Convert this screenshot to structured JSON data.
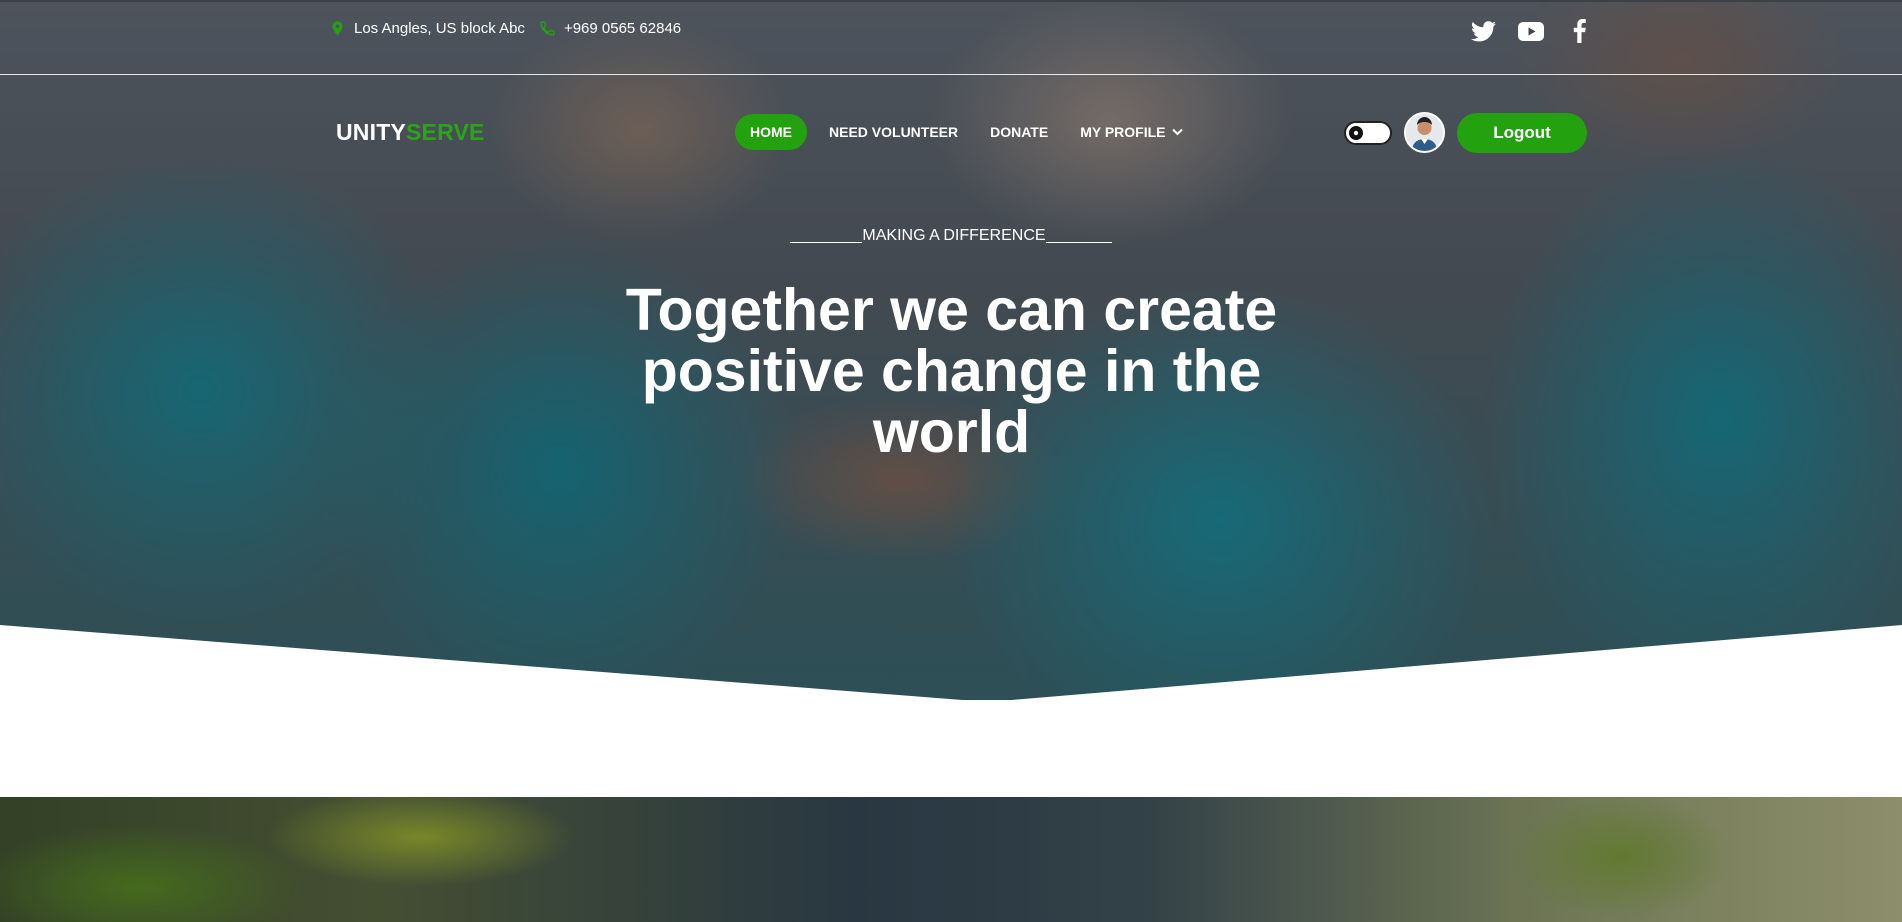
{
  "topbar": {
    "address": "Los Angles, US block Abc",
    "phone": "+969 0565 62846",
    "social": [
      {
        "name": "twitter-icon"
      },
      {
        "name": "youtube-icon"
      },
      {
        "name": "facebook-icon"
      }
    ]
  },
  "brand": {
    "part1": "UNITY",
    "part2": "SERVE"
  },
  "nav": {
    "home": "HOME",
    "need_volunteer": "NEED VOLUNTEER",
    "donate": "DONATE",
    "my_profile": "MY PROFILE"
  },
  "actions": {
    "logout": "Logout"
  },
  "hero": {
    "eyebrow": "MAKING A DIFFERENCE",
    "headline": "Together we can create positive change in the world"
  },
  "colors": {
    "accent": "#24a10f",
    "brand_green": "#2aa515",
    "text_on_dark": "#ffffff"
  }
}
